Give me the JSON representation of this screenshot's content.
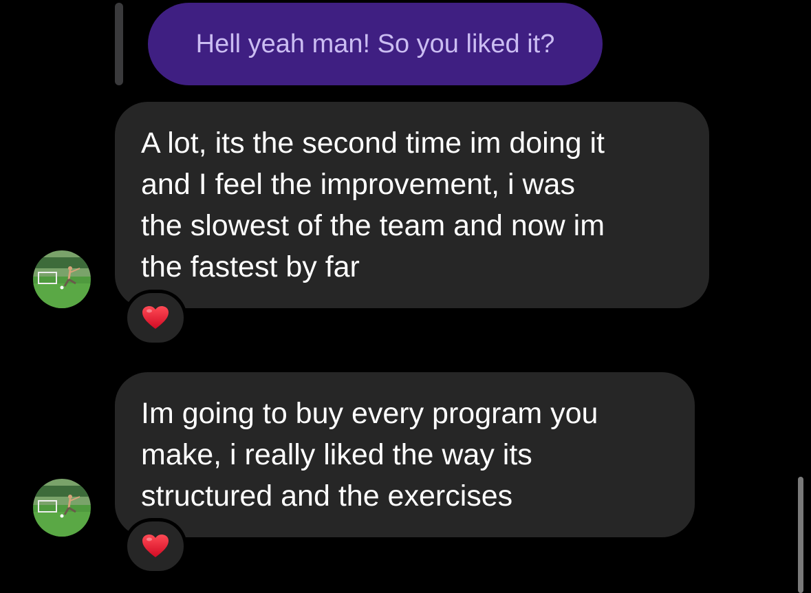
{
  "messages": [
    {
      "direction": "sent",
      "is_reply": true,
      "text": "Hell yeah man! So you liked it?"
    },
    {
      "direction": "received",
      "text": "A lot, its the second time im doing it\nand I feel the improvement, i was\nthe slowest of the team and now im\nthe fastest by far",
      "reaction": "❤️",
      "avatar_icon": "soccer-player-avatar"
    },
    {
      "direction": "received",
      "text": "Im going to buy every program you\nmake, i really liked the way its\nstructured and the exercises",
      "reaction": "❤️",
      "avatar_icon": "soccer-player-avatar"
    }
  ],
  "colors": {
    "background": "#000000",
    "sent_bubble": "#3f1f82",
    "sent_text": "#cbbdf2",
    "received_bubble": "#262626",
    "received_text": "#ffffff",
    "heart": "#e8112d"
  }
}
